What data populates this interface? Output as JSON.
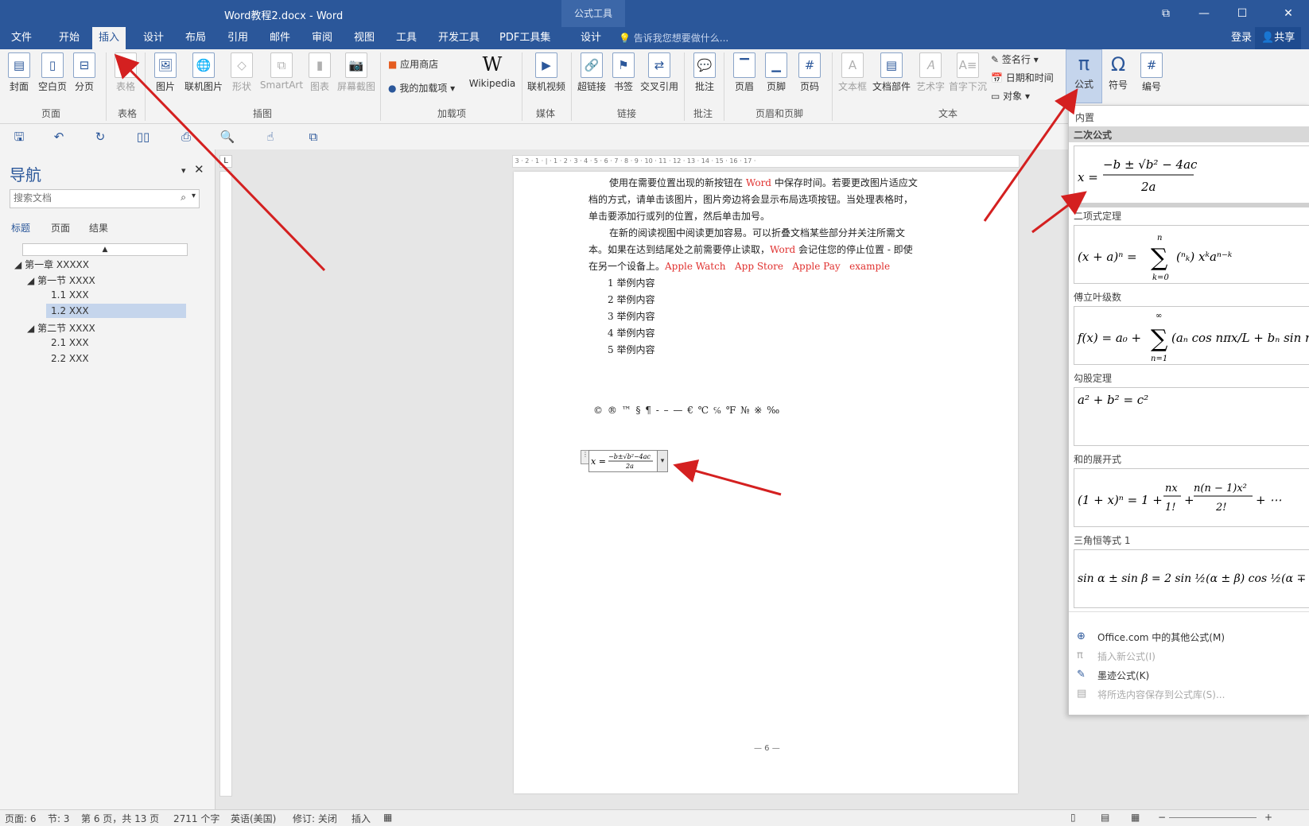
{
  "window": {
    "title": "Word教程2.docx - Word",
    "context_tab_group": "公式工具",
    "controls": [
      "⧉",
      "—",
      "☐",
      "✕"
    ]
  },
  "tabs": [
    "文件",
    "开始",
    "插入",
    "设计",
    "布局",
    "引用",
    "邮件",
    "审阅",
    "视图",
    "工具",
    "开发工具",
    "PDF工具集",
    "设计"
  ],
  "active_tab": "插入",
  "tell_me": "告诉我您想要做什么...",
  "account": {
    "login": "登录",
    "share": "共享"
  },
  "ribbon": {
    "groups": {
      "page": "页面",
      "table": "表格",
      "illustrations": "插图",
      "addins": "加载项",
      "media": "媒体",
      "links": "链接",
      "comments": "批注",
      "header_footer": "页眉和页脚",
      "text": "文本"
    },
    "buttons": {
      "cover": "封面",
      "blank": "空白页",
      "break": "分页",
      "table": "表格",
      "picture": "图片",
      "online_picture": "联机图片",
      "shapes": "形状",
      "smartart": "SmartArt",
      "chart": "图表",
      "screenshot": "屏幕截图",
      "store": "应用商店",
      "my_addins": "我的加载项",
      "wikipedia": "Wikipedia",
      "online_video": "联机视频",
      "hyperlink": "超链接",
      "bookmark": "书签",
      "crossref": "交叉引用",
      "comment": "批注",
      "header": "页眉",
      "footer": "页脚",
      "page_number": "页码",
      "textbox": "文本框",
      "quick_parts": "文档部件",
      "wordart": "艺术字",
      "dropcap": "首字下沉",
      "signature": "签名行",
      "datetime": "日期和时间",
      "object": "对象",
      "equation": "公式",
      "symbol": "符号",
      "number": "编号"
    }
  },
  "nav": {
    "title": "导航",
    "search_placeholder": "搜索文档",
    "tabs": [
      "标题",
      "页面",
      "结果"
    ],
    "tree": [
      {
        "label": "第一章 XXXXX",
        "level": 0,
        "expanded": true
      },
      {
        "label": "第一节 XXXX",
        "level": 1,
        "expanded": true
      },
      {
        "label": "1.1 XXX",
        "level": 2
      },
      {
        "label": "1.2 XXX",
        "level": 2,
        "selected": true
      },
      {
        "label": "第二节 XXXX",
        "level": 1,
        "expanded": true
      },
      {
        "label": "2.1 XXX",
        "level": 2
      },
      {
        "label": "2.2 XXX",
        "level": 2
      }
    ]
  },
  "document": {
    "para1": [
      "使用在需要位置出现的新按钮在 ",
      "Word",
      " 中保存时间。若要更改图片适应文",
      "档的方式，请单击该图片，图片旁边将会显示布局选项按钮。当处理表格时，",
      "单击要添加行或列的位置，然后单击加号。"
    ],
    "para2": [
      "在新的阅读视图中阅读更加容易。可以折叠文档某些部分并关注所需文",
      "本。如果在达到结尾处之前需要停止读取，",
      "Word",
      " 会记住您的停止位置 - 即使",
      "在另一个设备上。",
      "Apple Watch",
      "App Store",
      "Apple Pay",
      "example"
    ],
    "list": [
      "1 举例内容",
      "2 举例内容",
      "3 举例内容",
      "4 举例内容",
      "5 举例内容"
    ],
    "symbols": "© ® ™ § ¶ - – — € ℃ ℅ ℉ № ※ ‰",
    "page_footer": "— 6 —"
  },
  "equations": {
    "builtin": "内置",
    "items": [
      {
        "name": "二次公式"
      },
      {
        "name": "二项式定理"
      },
      {
        "name": "傅立叶级数"
      },
      {
        "name": "勾股定理"
      },
      {
        "name": "和的展开式"
      },
      {
        "name": "三角恒等式 1"
      }
    ],
    "menu": [
      {
        "label": "Office.com 中的其他公式(M)",
        "enabled": true
      },
      {
        "label": "插入新公式(I)",
        "enabled": false
      },
      {
        "label": "墨迹公式(K)",
        "enabled": true
      },
      {
        "label": "将所选内容保存到公式库(S)...",
        "enabled": false
      }
    ]
  },
  "status": {
    "page": "页面: 6",
    "section": "节: 3",
    "pages": "第 6 页，共 13 页",
    "words": "2711 个字",
    "lang": "英语(美国)",
    "revision": "修订: 关闭",
    "mode": "插入"
  },
  "colors": {
    "brand": "#2b579a",
    "accent_red": "#e0302e",
    "arrow": "#d42020"
  }
}
